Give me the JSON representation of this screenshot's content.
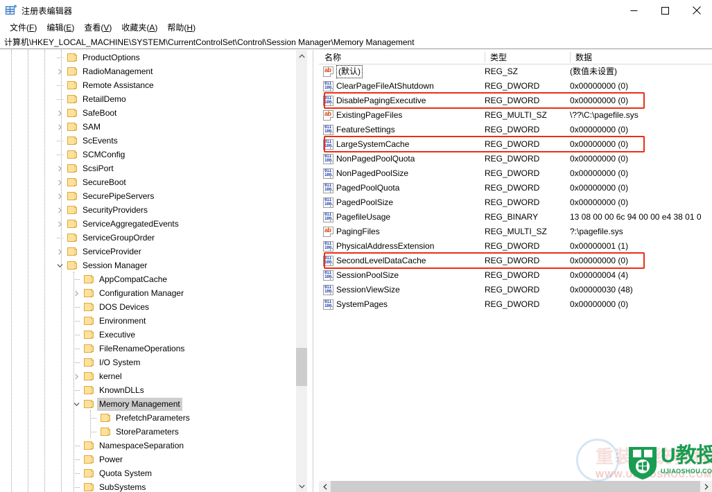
{
  "window": {
    "title": "注册表编辑器",
    "icon": "registry-editor-icon",
    "controls": {
      "minimize": "minimize-icon",
      "maximize": "maximize-icon",
      "close": "close-icon"
    }
  },
  "menubar": {
    "items": [
      {
        "text": "文件(F)",
        "pre": "文件(",
        "accel": "F",
        "post": ")"
      },
      {
        "text": "编辑(E)",
        "pre": "编辑(",
        "accel": "E",
        "post": ")"
      },
      {
        "text": "查看(V)",
        "pre": "查看(",
        "accel": "V",
        "post": ")"
      },
      {
        "text": "收藏夹(A)",
        "pre": "收藏夹(",
        "accel": "A",
        "post": ")"
      },
      {
        "text": "帮助(H)",
        "pre": "帮助(",
        "accel": "H",
        "post": ")"
      }
    ]
  },
  "address": {
    "path": "计算机\\HKEY_LOCAL_MACHINE\\SYSTEM\\CurrentControlSet\\Control\\Session Manager\\Memory Management"
  },
  "tree": {
    "items": [
      {
        "label": "ProductOptions",
        "depth": 3,
        "expandable": false,
        "expanded": false,
        "selected": false
      },
      {
        "label": "RadioManagement",
        "depth": 3,
        "expandable": true,
        "expanded": false,
        "selected": false
      },
      {
        "label": "Remote Assistance",
        "depth": 3,
        "expandable": false,
        "expanded": false,
        "selected": false
      },
      {
        "label": "RetailDemo",
        "depth": 3,
        "expandable": false,
        "expanded": false,
        "selected": false
      },
      {
        "label": "SafeBoot",
        "depth": 3,
        "expandable": true,
        "expanded": false,
        "selected": false
      },
      {
        "label": "SAM",
        "depth": 3,
        "expandable": true,
        "expanded": false,
        "selected": false
      },
      {
        "label": "ScEvents",
        "depth": 3,
        "expandable": false,
        "expanded": false,
        "selected": false
      },
      {
        "label": "SCMConfig",
        "depth": 3,
        "expandable": false,
        "expanded": false,
        "selected": false
      },
      {
        "label": "ScsiPort",
        "depth": 3,
        "expandable": true,
        "expanded": false,
        "selected": false
      },
      {
        "label": "SecureBoot",
        "depth": 3,
        "expandable": true,
        "expanded": false,
        "selected": false
      },
      {
        "label": "SecurePipeServers",
        "depth": 3,
        "expandable": true,
        "expanded": false,
        "selected": false
      },
      {
        "label": "SecurityProviders",
        "depth": 3,
        "expandable": true,
        "expanded": false,
        "selected": false
      },
      {
        "label": "ServiceAggregatedEvents",
        "depth": 3,
        "expandable": true,
        "expanded": false,
        "selected": false
      },
      {
        "label": "ServiceGroupOrder",
        "depth": 3,
        "expandable": false,
        "expanded": false,
        "selected": false
      },
      {
        "label": "ServiceProvider",
        "depth": 3,
        "expandable": true,
        "expanded": false,
        "selected": false
      },
      {
        "label": "Session Manager",
        "depth": 3,
        "expandable": true,
        "expanded": true,
        "selected": false
      },
      {
        "label": "AppCompatCache",
        "depth": 4,
        "expandable": false,
        "expanded": false,
        "selected": false
      },
      {
        "label": "Configuration Manager",
        "depth": 4,
        "expandable": true,
        "expanded": false,
        "selected": false
      },
      {
        "label": "DOS Devices",
        "depth": 4,
        "expandable": false,
        "expanded": false,
        "selected": false
      },
      {
        "label": "Environment",
        "depth": 4,
        "expandable": false,
        "expanded": false,
        "selected": false
      },
      {
        "label": "Executive",
        "depth": 4,
        "expandable": false,
        "expanded": false,
        "selected": false
      },
      {
        "label": "FileRenameOperations",
        "depth": 4,
        "expandable": false,
        "expanded": false,
        "selected": false
      },
      {
        "label": "I/O System",
        "depth": 4,
        "expandable": false,
        "expanded": false,
        "selected": false
      },
      {
        "label": "kernel",
        "depth": 4,
        "expandable": true,
        "expanded": false,
        "selected": false
      },
      {
        "label": "KnownDLLs",
        "depth": 4,
        "expandable": false,
        "expanded": false,
        "selected": false
      },
      {
        "label": "Memory Management",
        "depth": 4,
        "expandable": true,
        "expanded": true,
        "selected": true
      },
      {
        "label": "PrefetchParameters",
        "depth": 5,
        "expandable": false,
        "expanded": false,
        "selected": false
      },
      {
        "label": "StoreParameters",
        "depth": 5,
        "expandable": false,
        "expanded": false,
        "selected": false
      },
      {
        "label": "NamespaceSeparation",
        "depth": 4,
        "expandable": false,
        "expanded": false,
        "selected": false
      },
      {
        "label": "Power",
        "depth": 4,
        "expandable": false,
        "expanded": false,
        "selected": false
      },
      {
        "label": "Quota System",
        "depth": 4,
        "expandable": false,
        "expanded": false,
        "selected": false
      },
      {
        "label": "SubSystems",
        "depth": 4,
        "expandable": false,
        "expanded": false,
        "selected": false
      }
    ]
  },
  "list": {
    "columns": [
      {
        "label": "名称",
        "key": "name"
      },
      {
        "label": "类型",
        "key": "type"
      },
      {
        "label": "数据",
        "key": "data"
      }
    ],
    "rows": [
      {
        "name": "(默认)",
        "type": "REG_SZ",
        "data": "(数值未设置)",
        "icon": "string-value-icon",
        "highlighted": false,
        "focused": true
      },
      {
        "name": "ClearPageFileAtShutdown",
        "type": "REG_DWORD",
        "data": "0x00000000 (0)",
        "icon": "dword-value-icon",
        "highlighted": false,
        "focused": false
      },
      {
        "name": "DisablePagingExecutive",
        "type": "REG_DWORD",
        "data": "0x00000000 (0)",
        "icon": "dword-value-icon",
        "highlighted": true,
        "focused": false
      },
      {
        "name": "ExistingPageFiles",
        "type": "REG_MULTI_SZ",
        "data": "\\??\\C:\\pagefile.sys",
        "icon": "string-value-icon",
        "highlighted": false,
        "focused": false
      },
      {
        "name": "FeatureSettings",
        "type": "REG_DWORD",
        "data": "0x00000000 (0)",
        "icon": "dword-value-icon",
        "highlighted": false,
        "focused": false
      },
      {
        "name": "LargeSystemCache",
        "type": "REG_DWORD",
        "data": "0x00000000 (0)",
        "icon": "dword-value-icon",
        "highlighted": true,
        "focused": false
      },
      {
        "name": "NonPagedPoolQuota",
        "type": "REG_DWORD",
        "data": "0x00000000 (0)",
        "icon": "dword-value-icon",
        "highlighted": false,
        "focused": false
      },
      {
        "name": "NonPagedPoolSize",
        "type": "REG_DWORD",
        "data": "0x00000000 (0)",
        "icon": "dword-value-icon",
        "highlighted": false,
        "focused": false
      },
      {
        "name": "PagedPoolQuota",
        "type": "REG_DWORD",
        "data": "0x00000000 (0)",
        "icon": "dword-value-icon",
        "highlighted": false,
        "focused": false
      },
      {
        "name": "PagedPoolSize",
        "type": "REG_DWORD",
        "data": "0x00000000 (0)",
        "icon": "dword-value-icon",
        "highlighted": false,
        "focused": false
      },
      {
        "name": "PagefileUsage",
        "type": "REG_BINARY",
        "data": "13 08 00 00 6c 94 00 00 e4 38 01 0",
        "icon": "dword-value-icon",
        "highlighted": false,
        "focused": false
      },
      {
        "name": "PagingFiles",
        "type": "REG_MULTI_SZ",
        "data": "?:\\pagefile.sys",
        "icon": "string-value-icon",
        "highlighted": false,
        "focused": false
      },
      {
        "name": "PhysicalAddressExtension",
        "type": "REG_DWORD",
        "data": "0x00000001 (1)",
        "icon": "dword-value-icon",
        "highlighted": false,
        "focused": false
      },
      {
        "name": "SecondLevelDataCache",
        "type": "REG_DWORD",
        "data": "0x00000000 (0)",
        "icon": "dword-value-icon",
        "highlighted": true,
        "focused": false
      },
      {
        "name": "SessionPoolSize",
        "type": "REG_DWORD",
        "data": "0x00000004 (4)",
        "icon": "dword-value-icon",
        "highlighted": false,
        "focused": false
      },
      {
        "name": "SessionViewSize",
        "type": "REG_DWORD",
        "data": "0x00000030 (48)",
        "icon": "dword-value-icon",
        "highlighted": false,
        "focused": false
      },
      {
        "name": "SystemPages",
        "type": "REG_DWORD",
        "data": "0x00000000 (0)",
        "icon": "dword-value-icon",
        "highlighted": false,
        "focused": false
      }
    ]
  },
  "watermark": {
    "brand": "U教授",
    "domain": "UJIAOSHOU.COM",
    "ghost": "重装系统教程",
    "ghost_sub": "WWW.UJIAOSHOU.COM",
    "color": "#1a9d52"
  },
  "colors": {
    "highlight_border": "#ee2c15",
    "selection": "#cecece",
    "scrollbar_thumb": "#cdcdcd",
    "scrollbar_track": "#f0f0f0"
  }
}
